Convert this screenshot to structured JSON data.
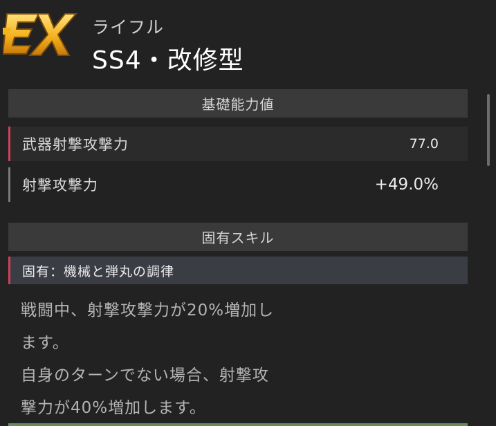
{
  "header": {
    "logo_text": "EX",
    "weapon_type": "ライフル",
    "weapon_name": "SS4・改修型"
  },
  "base_stats": {
    "title": "基礎能力値",
    "rows": [
      {
        "label": "武器射撃攻撃力",
        "value": "77.0",
        "accent": "#d0405a"
      },
      {
        "label": "射撃攻撃力",
        "value": "+49.0%",
        "accent": "#7a7a7a"
      }
    ]
  },
  "unique_skill": {
    "title": "固有スキル",
    "name": "固有：機械と弾丸の調律",
    "description_lines": [
      "戦闘中、射撃攻撃力が20%増加し",
      "ます。",
      "自身のターンでない場合、射撃攻",
      "撃力が40%増加します。"
    ]
  },
  "colors": {
    "background": "#222222",
    "section_header": "#3a3a3a",
    "accent_red": "#d0405a",
    "logo_gold": "#f4b21e"
  }
}
